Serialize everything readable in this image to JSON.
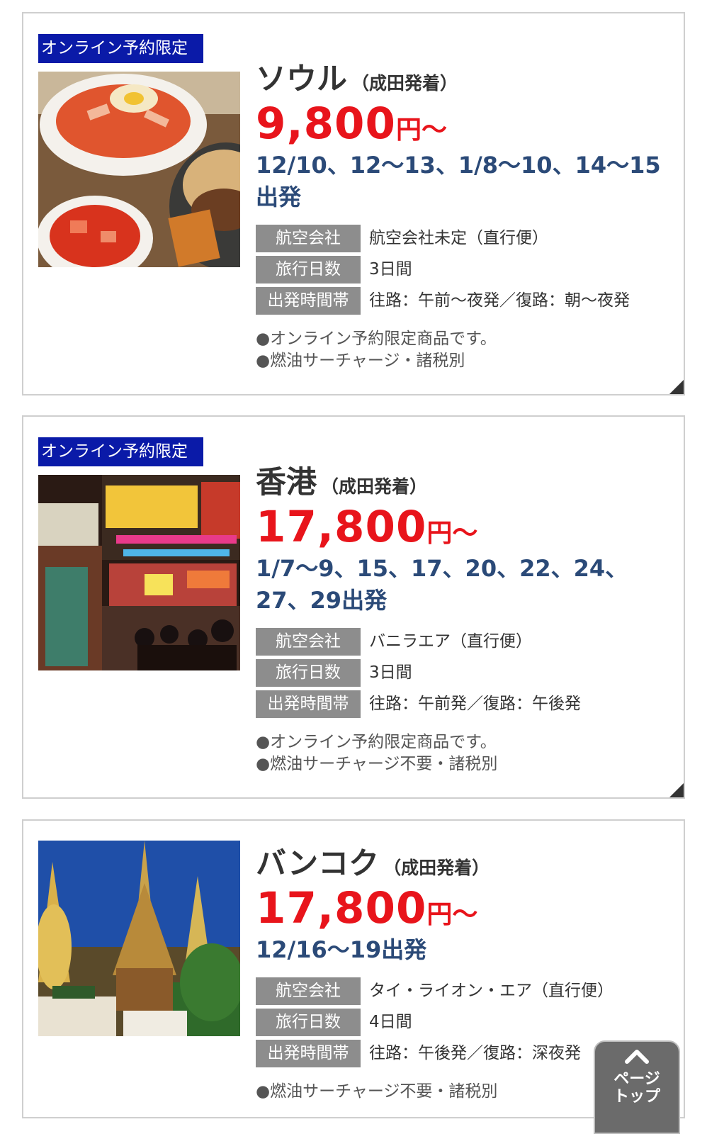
{
  "tours": [
    {
      "badge": "オンライン予約限定",
      "name": "ソウル",
      "sub": "（成田発着）",
      "price": "9,800",
      "unit": "円〜",
      "dates": "12/10、12〜13、1/8〜10、14〜15出発",
      "specs": [
        {
          "label": "航空会社",
          "value": "航空会社未定（直行便）"
        },
        {
          "label": "旅行日数",
          "value": "3日間"
        },
        {
          "label": "出発時間帯",
          "value": "往路：午前〜夜発／復路：朝〜夜発"
        }
      ],
      "notes": [
        "●オンライン予約限定商品です。",
        "●燃油サーチャージ・諸税別"
      ]
    },
    {
      "badge": "オンライン予約限定",
      "name": "香港",
      "sub": "（成田発着）",
      "price": "17,800",
      "unit": "円〜",
      "dates": "1/7〜9、15、17、20、22、24、27、29出発",
      "specs": [
        {
          "label": "航空会社",
          "value": "バニラエア（直行便）"
        },
        {
          "label": "旅行日数",
          "value": "3日間"
        },
        {
          "label": "出発時間帯",
          "value": "往路：午前発／復路：午後発"
        }
      ],
      "notes": [
        "●オンライン予約限定商品です。",
        "●燃油サーチャージ不要・諸税別"
      ]
    },
    {
      "name": "バンコク",
      "sub": "（成田発着）",
      "price": "17,800",
      "unit": "円〜",
      "dates": "12/16〜19出発",
      "specs": [
        {
          "label": "航空会社",
          "value": "タイ・ライオン・エア（直行便）"
        },
        {
          "label": "旅行日数",
          "value": "4日間"
        },
        {
          "label": "出発時間帯",
          "value": "往路：午後発／復路：深夜発"
        }
      ],
      "notes": [
        "●燃油サーチャージ不要・諸税別"
      ]
    }
  ],
  "page_top": {
    "label": "ページトップ",
    "icon": "chevron-up-icon"
  },
  "colors": {
    "badge": "#0a1aa8",
    "price": "#e8141b",
    "dates": "#2b4a78",
    "label_bg": "#8d8d8d"
  }
}
